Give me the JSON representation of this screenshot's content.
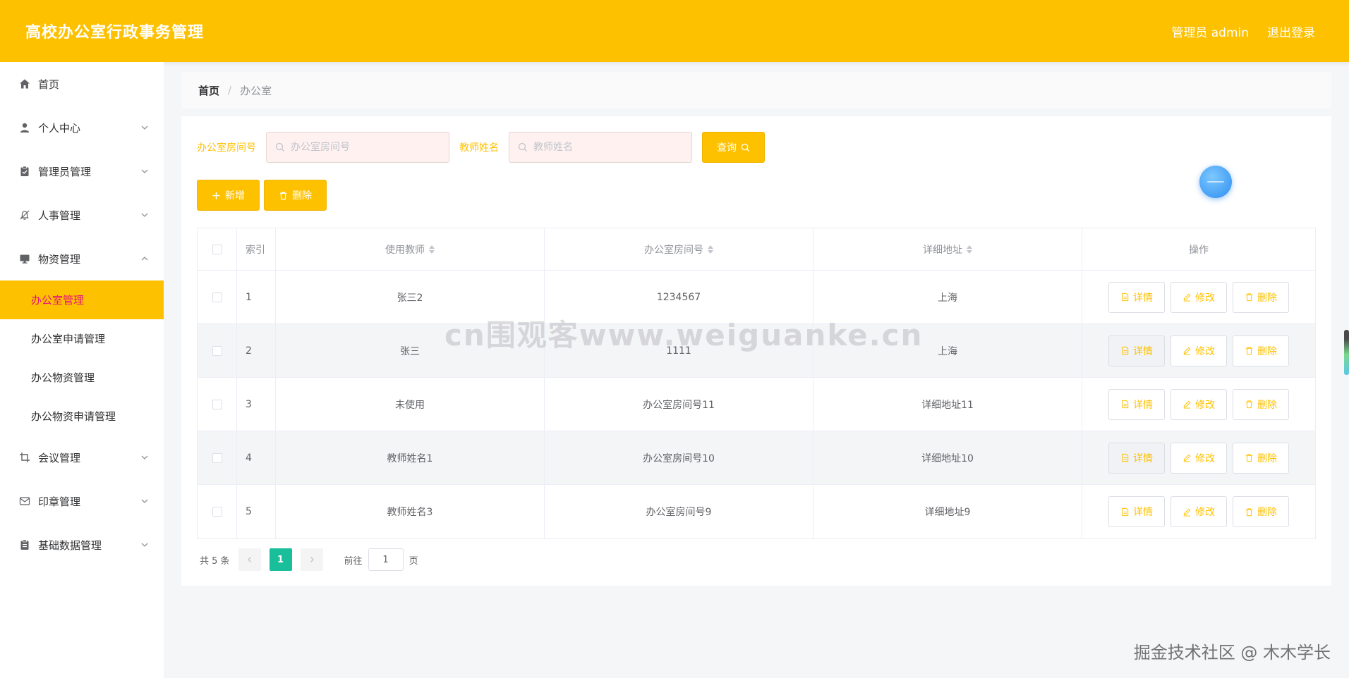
{
  "header": {
    "title": "高校办公室行政事务管理",
    "user_label": "管理员 admin",
    "logout_label": "退出登录"
  },
  "sidebar": {
    "items": [
      {
        "label": "首页",
        "icon": "home-icon",
        "expandable": false
      },
      {
        "label": "个人中心",
        "icon": "user-icon",
        "expandable": true
      },
      {
        "label": "管理员管理",
        "icon": "clipboard-check-icon",
        "expandable": true
      },
      {
        "label": "人事管理",
        "icon": "bell-off-icon",
        "expandable": true
      },
      {
        "label": "物资管理",
        "icon": "monitor-icon",
        "expandable": true,
        "expanded": true
      }
    ],
    "sub_items": [
      {
        "label": "办公室管理",
        "active": true
      },
      {
        "label": "办公室申请管理",
        "active": false
      },
      {
        "label": "办公物资管理",
        "active": false
      },
      {
        "label": "办公物资申请管理",
        "active": false
      }
    ],
    "items_after": [
      {
        "label": "会议管理",
        "icon": "crop-icon",
        "expandable": true
      },
      {
        "label": "印章管理",
        "icon": "mail-icon",
        "expandable": true
      },
      {
        "label": "基础数据管理",
        "icon": "clipboard-icon",
        "expandable": true
      }
    ]
  },
  "breadcrumb": {
    "home": "首页",
    "separator": "/",
    "current": "办公室"
  },
  "search": {
    "room_label": "办公室房间号",
    "room_placeholder": "办公室房间号",
    "teacher_label": "教师姓名",
    "teacher_placeholder": "教师姓名",
    "query_label": "查询"
  },
  "actions": {
    "add_label": "新增",
    "delete_label": "删除"
  },
  "table": {
    "headers": {
      "index": "索引",
      "teacher": "使用教师",
      "room": "办公室房间号",
      "address": "详细地址",
      "ops": "操作"
    },
    "rows": [
      {
        "index": "1",
        "teacher": "张三2",
        "room": "1234567",
        "address": "上海"
      },
      {
        "index": "2",
        "teacher": "张三",
        "room": "1111",
        "address": "上海"
      },
      {
        "index": "3",
        "teacher": "未使用",
        "room": "办公室房间号11",
        "address": "详细地址11"
      },
      {
        "index": "4",
        "teacher": "教师姓名1",
        "room": "办公室房间号10",
        "address": "详细地址10"
      },
      {
        "index": "5",
        "teacher": "教师姓名3",
        "room": "办公室房间号9",
        "address": "详细地址9"
      }
    ],
    "op_labels": {
      "detail": "详情",
      "edit": "修改",
      "delete": "删除"
    }
  },
  "pagination": {
    "total": "共 5 条",
    "current_page": "1",
    "goto_label": "前往",
    "goto_value": "1",
    "page_suffix": "页"
  },
  "watermarks": {
    "center": "cn围观客www.weiguanke.cn",
    "corner": "掘金技术社区 @ 木木学长"
  },
  "colors": {
    "primary": "#fec100",
    "active_text": "#e4107e",
    "page_active": "#19be9b"
  }
}
